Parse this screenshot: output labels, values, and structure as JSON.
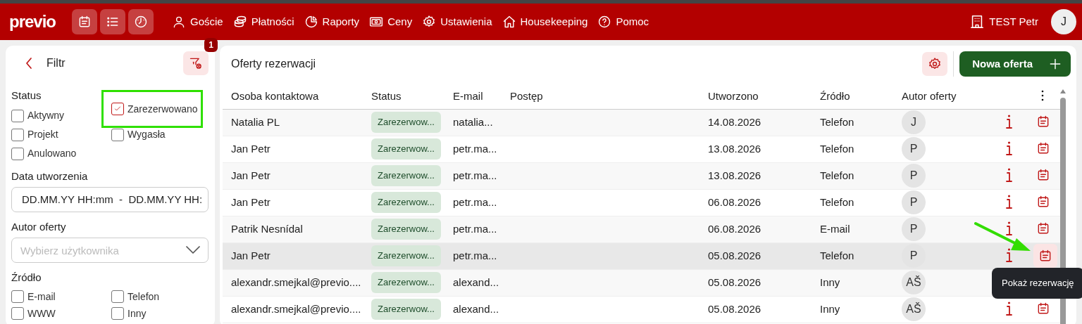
{
  "navbar": {
    "logo": "previo",
    "menu": [
      {
        "label": "Goście"
      },
      {
        "label": "Płatności"
      },
      {
        "label": "Raporty"
      },
      {
        "label": "Ceny"
      },
      {
        "label": "Ustawienia"
      },
      {
        "label": "Housekeeping"
      },
      {
        "label": "Pomoc"
      }
    ],
    "property": "TEST Petr",
    "avatar": "J"
  },
  "filter": {
    "title": "Filtr",
    "badge": "1",
    "status": {
      "label": "Status",
      "options": [
        {
          "label": "Aktywny",
          "checked": false,
          "highlighted": false
        },
        {
          "label": "Zarezerwowano",
          "checked": true,
          "highlighted": true
        },
        {
          "label": "Projekt",
          "checked": false,
          "highlighted": false
        },
        {
          "label": "Wygasła",
          "checked": false,
          "highlighted": false
        },
        {
          "label": "Anulowano",
          "checked": false,
          "highlighted": false
        }
      ]
    },
    "created": {
      "label": "Data utworzenia",
      "value": "DD.MM.YY HH:mm  -  DD.MM.YY HH:"
    },
    "author": {
      "label": "Autor oferty",
      "placeholder": "Wybierz użytkownika"
    },
    "source": {
      "label": "Źródło",
      "options": [
        {
          "label": "E-mail",
          "checked": false
        },
        {
          "label": "Telefon",
          "checked": false
        },
        {
          "label": "WWW",
          "checked": false
        },
        {
          "label": "Inny",
          "checked": false
        }
      ]
    }
  },
  "offers": {
    "title": "Oferty rezerwacji",
    "new_button": "Nowa oferta",
    "columns": [
      "Osoba kontaktowa",
      "Status",
      "E-mail",
      "Postęp",
      "Utworzono",
      "Źródło",
      "Autor oferty"
    ],
    "rows": [
      {
        "contact": "Natalia PL",
        "status": "Zarezerwow...",
        "email": "natalia...",
        "created": "14.08.2026",
        "source": "Telefon",
        "author": "J",
        "hovered": false
      },
      {
        "contact": "Jan Petr",
        "status": "Zarezerwow...",
        "email": "petr.ma...",
        "created": "13.08.2026",
        "source": "Telefon",
        "author": "P",
        "hovered": false
      },
      {
        "contact": "Jan Petr",
        "status": "Zarezerwow...",
        "email": "petr.ma...",
        "created": "13.08.2026",
        "source": "Telefon",
        "author": "P",
        "hovered": false
      },
      {
        "contact": "Jan Petr",
        "status": "Zarezerwow...",
        "email": "petr.ma...",
        "created": "06.08.2026",
        "source": "Telefon",
        "author": "P",
        "hovered": false
      },
      {
        "contact": "Patrik Nesnídal",
        "status": "Zarezerwow...",
        "email": "petr.ma...",
        "created": "06.08.2026",
        "source": "E-mail",
        "author": "P",
        "hovered": false
      },
      {
        "contact": "Jan Petr",
        "status": "Zarezerwow...",
        "email": "petr.ma...",
        "created": "05.08.2026",
        "source": "Telefon",
        "author": "P",
        "hovered": true,
        "tooltip": "Pokaż rezerwację"
      },
      {
        "contact": "alexandr.smejkal@previo....",
        "status": "Zarezerwow...",
        "email": "alexand...",
        "created": "05.08.2026",
        "source": "Inny",
        "author": "AŠ",
        "hovered": false
      },
      {
        "contact": "alexandr.smejkal@previo....",
        "status": "Zarezerwow...",
        "email": "alexand...",
        "created": "05.08.2026",
        "source": "Inny",
        "author": "AŠ",
        "hovered": false
      }
    ]
  }
}
